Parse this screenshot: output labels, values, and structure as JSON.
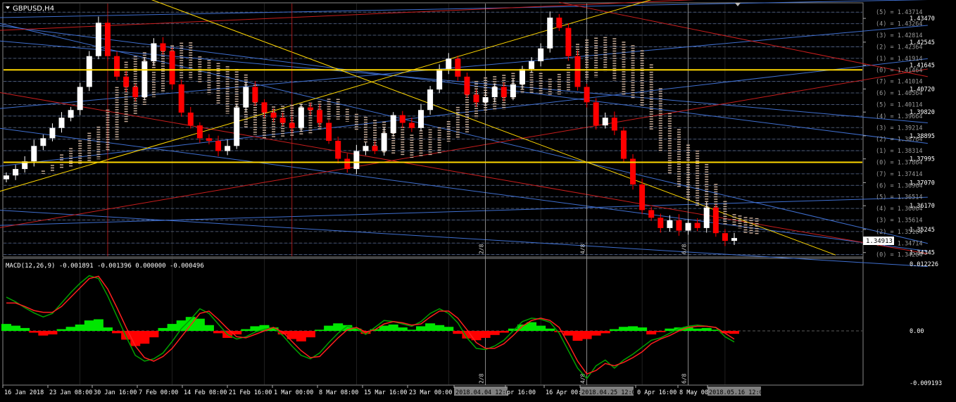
{
  "window": {
    "title": "GBPUSD,H4"
  },
  "colors": {
    "bull": "#ffffff",
    "bear": "#ff0000",
    "grid": "#5a5a5a",
    "cloud": "#e8c8b0",
    "fib": "#3f6fd0",
    "fib_red": "#c81e1e",
    "yellow": "#ffd700",
    "macd_pos": "#00e600",
    "macd_neg": "#ff0000",
    "macd_line": "#00a000",
    "signal_line": "#ff1e1e",
    "current_price_bg": "#ffffff"
  },
  "main_chart": {
    "symbol": "GBPUSD",
    "timeframe": "H4",
    "ylim": [
      1.342,
      1.4405
    ],
    "y_ticks": [
      "1.43470",
      "1.42545",
      "1.41645",
      "1.40720",
      "1.39820",
      "1.38895",
      "1.37995",
      "1.37070",
      "1.36170",
      "1.35245",
      "1.34345"
    ],
    "current_price": "1.34913",
    "fib_levels": [
      {
        "label": "(5) = 1.43714",
        "value": 1.43714
      },
      {
        "label": "(4) = 1.43264",
        "value": 1.43264
      },
      {
        "label": "(3) = 1.42814",
        "value": 1.42814
      },
      {
        "label": "(2) = 1.42364",
        "value": 1.42364
      },
      {
        "label": "(1) = 1.41914",
        "value": 1.41914
      },
      {
        "label": "(0) = 1.41464",
        "value": 1.41464
      },
      {
        "label": "(7) = 1.41014",
        "value": 1.41014
      },
      {
        "label": "(6) = 1.40564",
        "value": 1.40564
      },
      {
        "label": "(5) = 1.40114",
        "value": 1.40114
      },
      {
        "label": "(4) = 1.39664",
        "value": 1.39664
      },
      {
        "label": "(3) = 1.39214",
        "value": 1.39214
      },
      {
        "label": "(2) = 1.38764",
        "value": 1.38764
      },
      {
        "label": "(1) = 1.38314",
        "value": 1.38314
      },
      {
        "label": "(0) = 1.37864",
        "value": 1.37864
      },
      {
        "label": "(7) = 1.37414",
        "value": 1.37414
      },
      {
        "label": "(6) = 1.36964",
        "value": 1.36964
      },
      {
        "label": "(5) = 1.36514",
        "value": 1.36514
      },
      {
        "label": "(4) = 1.36064",
        "value": 1.36064
      },
      {
        "label": "(3) = 1.35614",
        "value": 1.35614
      },
      {
        "label": "(2) = 1.35164",
        "value": 1.35164
      },
      {
        "label": "(1) = 1.34714",
        "value": 1.34714
      },
      {
        "label": "(0) = 1.34264",
        "value": 1.34264
      }
    ],
    "horizontal_levels": [
      1.41464,
      1.37864
    ],
    "vertical_markers": [
      "2/8",
      "4/8",
      "6/8"
    ]
  },
  "chart_data": {
    "type": "candlestick",
    "series": [
      {
        "name": "GBPUSD H4",
        "values": [
          1.3735,
          1.376,
          1.379,
          1.385,
          1.388,
          1.392,
          1.396,
          1.399,
          1.408,
          1.42,
          1.433,
          1.42,
          1.412,
          1.408,
          1.404,
          1.418,
          1.425,
          1.422,
          1.409,
          1.398,
          1.393,
          1.388,
          1.387,
          1.383,
          1.385,
          1.4,
          1.408,
          1.402,
          1.398,
          1.396,
          1.394,
          1.392,
          1.4,
          1.399,
          1.394,
          1.387,
          1.38,
          1.376,
          1.383,
          1.385,
          1.383,
          1.39,
          1.397,
          1.394,
          1.392,
          1.399,
          1.407,
          1.415,
          1.419,
          1.412,
          1.405,
          1.402,
          1.404,
          1.408,
          1.404,
          1.409,
          1.415,
          1.418,
          1.423,
          1.435,
          1.431,
          1.42,
          1.408,
          1.402,
          1.393,
          1.396,
          1.391,
          1.38,
          1.37,
          1.36,
          1.357,
          1.353,
          1.356,
          1.352,
          1.355,
          1.353,
          1.361,
          1.351,
          1.348,
          1.3491
        ]
      }
    ],
    "macd": {
      "label": "MACD(12,26,9) -0.001891 -0.001396 0.000000 -0.000496",
      "ylim": [
        -0.009193,
        0.012226
      ],
      "y_ticks": [
        "0.012226",
        "0.00",
        "-0.009193"
      ],
      "histogram": [
        0.0012,
        0.0009,
        0.0005,
        -0.0003,
        -0.0008,
        -0.0006,
        0.0003,
        0.0007,
        0.0011,
        0.0018,
        0.002,
        0.0006,
        -0.0004,
        -0.0015,
        -0.0026,
        -0.0022,
        -0.0011,
        0.0005,
        0.0012,
        0.0018,
        0.0024,
        0.0021,
        0.001,
        -0.0004,
        -0.0012,
        -0.0006,
        0.0003,
        0.0008,
        0.001,
        0.0006,
        -0.0006,
        -0.0014,
        -0.0018,
        -0.0011,
        0.0002,
        0.0009,
        0.0013,
        0.001,
        0.0004,
        -0.0005,
        0.0003,
        0.0009,
        0.0011,
        0.0006,
        0.0002,
        0.0008,
        0.0013,
        0.001,
        0.0007,
        -0.0005,
        -0.0013,
        -0.0016,
        -0.0012,
        -0.0007,
        -0.0003,
        0.0004,
        0.0011,
        0.0015,
        0.0009,
        0.0004,
        -0.0002,
        -0.0008,
        -0.0017,
        -0.0014,
        -0.0008,
        -0.0004,
        0.0003,
        0.0007,
        0.0008,
        0.0006,
        -0.0006,
        -0.0002,
        0.0004,
        0.0006,
        0.0007,
        0.0004,
        0.0005,
        0.0002,
        -0.0004,
        -0.0005
      ],
      "macd_line": [
        0.0058,
        0.005,
        0.004,
        0.0031,
        0.0024,
        0.003,
        0.0048,
        0.0066,
        0.0082,
        0.0095,
        0.009,
        0.006,
        0.0025,
        -0.001,
        -0.0042,
        -0.0052,
        -0.0048,
        -0.0038,
        -0.0018,
        0.0004,
        0.002,
        0.0038,
        0.003,
        0.0012,
        -0.0006,
        -0.0014,
        -0.001,
        -0.0002,
        0.0003,
        0.0006,
        -0.0008,
        -0.0026,
        -0.0042,
        -0.0048,
        -0.0038,
        -0.002,
        -0.0004,
        0.0008,
        0.0004,
        -0.0006,
        0.0006,
        0.0018,
        0.0016,
        0.0012,
        0.0008,
        0.0016,
        0.003,
        0.0038,
        0.003,
        0.0014,
        -0.0012,
        -0.003,
        -0.0032,
        -0.0026,
        -0.0016,
        0.0,
        0.0016,
        0.0022,
        0.002,
        0.0015,
        -0.0004,
        -0.0034,
        -0.0064,
        -0.0082,
        -0.006,
        -0.005,
        -0.0064,
        -0.005,
        -0.004,
        -0.0028,
        -0.0016,
        -0.0012,
        -0.0004,
        0.0004,
        0.0008,
        0.001,
        0.0008,
        0.0006,
        -0.001,
        -0.0019
      ],
      "signal_line": [
        0.0048,
        0.0048,
        0.0042,
        0.0035,
        0.0032,
        0.0032,
        0.0042,
        0.0058,
        0.0074,
        0.009,
        0.0094,
        0.0072,
        0.004,
        0.0006,
        -0.0026,
        -0.0046,
        -0.0052,
        -0.0044,
        -0.003,
        -0.001,
        0.001,
        0.003,
        0.0034,
        0.002,
        0.0004,
        -0.001,
        -0.0012,
        -0.0006,
        0.0,
        0.0006,
        -0.0002,
        -0.0018,
        -0.0034,
        -0.0046,
        -0.0044,
        -0.0028,
        -0.0012,
        0.0002,
        0.0006,
        -0.0002,
        0.0002,
        0.0012,
        0.0016,
        0.0014,
        0.001,
        0.0012,
        0.0024,
        0.0034,
        0.0034,
        0.0022,
        0.0002,
        -0.002,
        -0.003,
        -0.003,
        -0.0022,
        -0.0008,
        0.0008,
        0.0018,
        0.0022,
        0.0018,
        0.0006,
        -0.0022,
        -0.0052,
        -0.0074,
        -0.0068,
        -0.0056,
        -0.006,
        -0.0054,
        -0.0046,
        -0.0036,
        -0.0022,
        -0.0014,
        -0.0008,
        0.0,
        0.0006,
        0.0008,
        0.0008,
        0.0006,
        -0.0004,
        -0.0014
      ]
    },
    "x_tick_labels": [
      "16 Jan 2018",
      "23 Jan 08:00",
      "30 Jan 16:00",
      "7 Feb 00:00",
      "14 Feb 08:00",
      "21 Feb 16:00",
      "1 Mar 00:00",
      "8 Mar 08:00",
      "15 Mar 16:00",
      "23 Mar 00:00",
      "2018.04.04 12:00",
      "pr 16:00",
      "16 Apr 00:00",
      "2018.04.25 12:00",
      "0 Apr 16:00",
      "8 May 00:00",
      "2018.05.16 12:00"
    ],
    "grid": true
  }
}
